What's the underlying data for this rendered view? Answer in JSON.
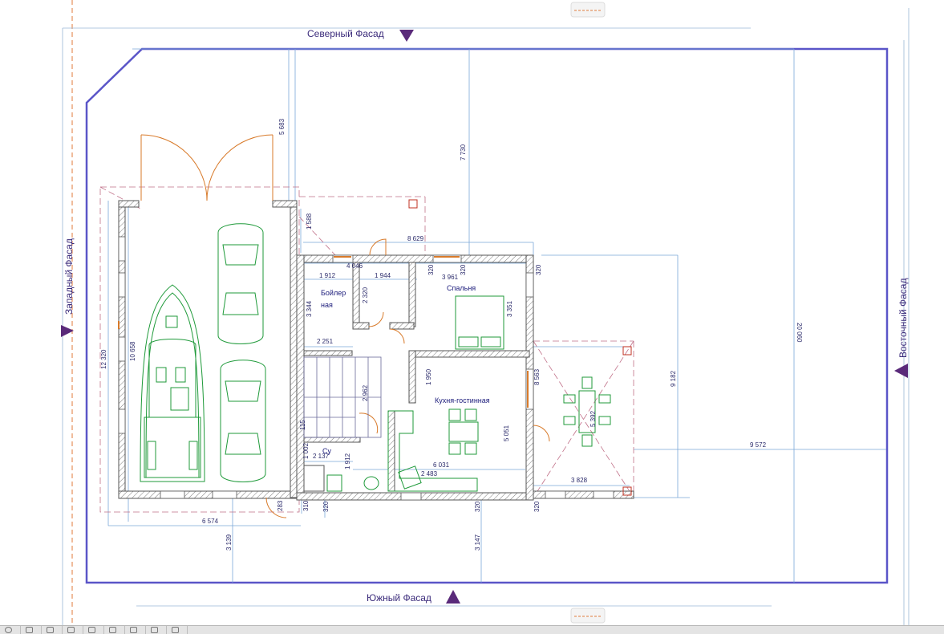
{
  "facades": {
    "north": "Северный Фасад",
    "south": "Южный Фасад",
    "west": "Западный Фасад",
    "east": "Восточный Фасад"
  },
  "rooms": {
    "boiler_line1": "Бойлер",
    "boiler_line2": "ная",
    "bedroom": "Спальня",
    "kitchen_living": "Кухня-гостинная",
    "wc": "Су"
  },
  "dimensions": {
    "d_5683": "5 683",
    "d_7730": "7 730",
    "d_20060": "20 060",
    "d_1588": "1 588",
    "d_8629": "8 629",
    "d_4046": "4 046",
    "d_1912a": "1 912",
    "d_1944": "1 944",
    "d_320a": "320",
    "d_320b": "320",
    "d_3961": "3 961",
    "d_320c": "320",
    "d_3344": "3 344",
    "d_2320": "2 320",
    "d_3351": "3 351",
    "d_2251": "2 251",
    "d_12320": "12 320",
    "d_10658": "10 658",
    "d_1950": "1 950",
    "d_2962": "2 962",
    "d_8563": "8 563",
    "d_9182": "9 182",
    "d_5392": "5 392",
    "d_5051": "5 051",
    "d_9572": "9 572",
    "d_2137": "2 137",
    "d_1912b": "1 912",
    "d_6031": "6 031",
    "d_2483": "2 483",
    "d_3828": "3 828",
    "d_283": "283",
    "d_310": "310",
    "d_320d": "320",
    "d_320e": "320",
    "d_320f": "320",
    "d_6574": "6 574",
    "d_3139": "3 139",
    "d_3147": "3 147",
    "d_115": "115",
    "d_1002": "1 002"
  },
  "colors": {
    "site_border": "#5a55c8",
    "wall": "#555555",
    "dim_line": "#7aa8d8",
    "furniture": "#1f9a3a",
    "door": "#d87a2a",
    "marker": "#5a2a7a"
  },
  "status_items": [
    "",
    "",
    "",
    "",
    "",
    "",
    "",
    "",
    ""
  ]
}
